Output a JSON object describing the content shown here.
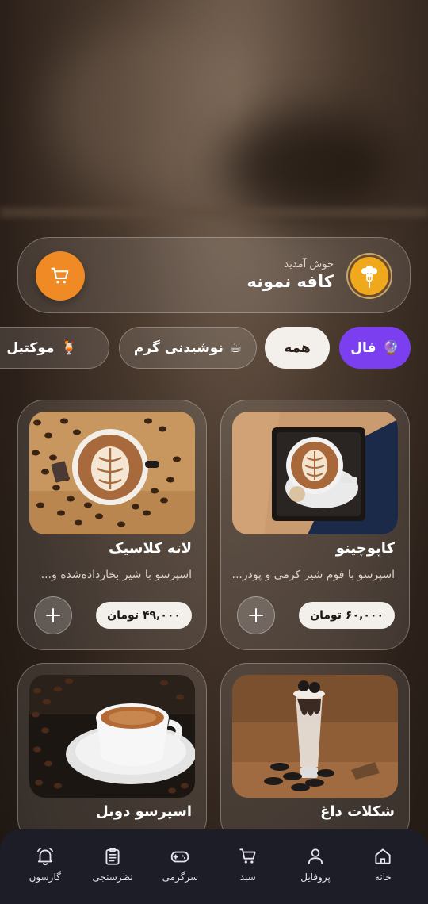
{
  "header": {
    "welcome": "خوش آمدید",
    "cafe_name": "کافه نمونه"
  },
  "categories": [
    {
      "label": "فال",
      "icon": "crystal-ball-icon",
      "glyph": "🔮",
      "state": "highlighted"
    },
    {
      "label": "همه",
      "state": "selected"
    },
    {
      "label": "نوشیدنی گرم",
      "icon": "hot-coffee-icon",
      "glyph": "☕"
    },
    {
      "label": "موکتیل",
      "icon": "tropical-drink-icon",
      "glyph": "🍹"
    }
  ],
  "products": [
    {
      "name": "کاپوچینو",
      "description": "اسپرسو با فوم شیر کرمی و پودر...",
      "price": "۶۰,۰۰۰ تومان",
      "image": "cappuccino-photo"
    },
    {
      "name": "لاته کلاسیک",
      "description": "اسپرسو با شیر بخارداده‌شده و...",
      "price": "۴۹,۰۰۰ تومان",
      "image": "latte-photo"
    },
    {
      "name": "شکلات داغ",
      "image": "hot-chocolate-photo"
    },
    {
      "name": "اسپرسو دوبل",
      "image": "double-espresso-photo"
    }
  ],
  "nav": [
    {
      "label": "خانه",
      "icon": "home-icon"
    },
    {
      "label": "پروفایل",
      "icon": "user-icon"
    },
    {
      "label": "سبد",
      "icon": "cart-icon"
    },
    {
      "label": "سرگرمی",
      "icon": "gamepad-icon"
    },
    {
      "label": "نظرسنجی",
      "icon": "clipboard-icon"
    },
    {
      "label": "گارسون",
      "icon": "bell-icon"
    }
  ],
  "colors": {
    "accent_orange": "#f08a24",
    "fal_purple": "#7b3ff0",
    "logo_yellow": "#f0a81c",
    "nav_bg": "#1c1d27"
  }
}
